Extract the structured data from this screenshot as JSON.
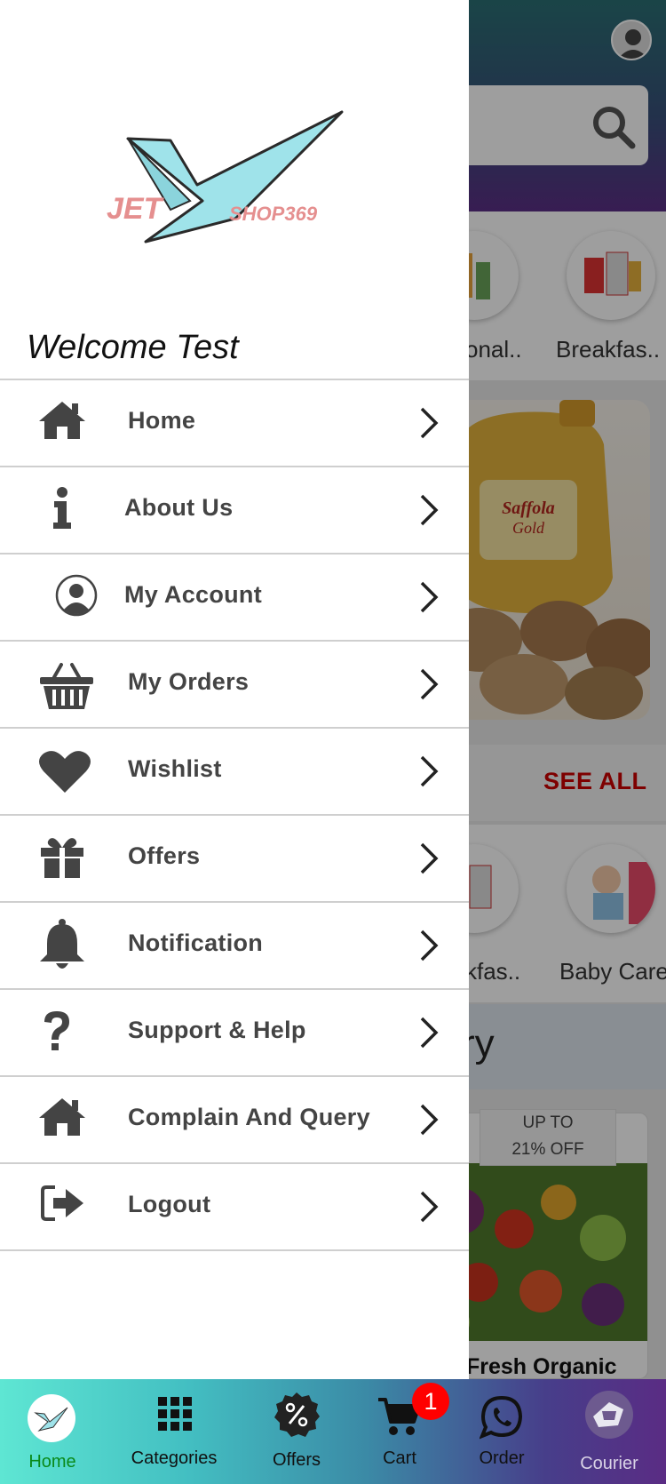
{
  "background": {
    "categories_row1": [
      {
        "label": "onal.."
      },
      {
        "label": "Breakfas.."
      }
    ],
    "see_all": "SEE ALL",
    "categories_row2": [
      {
        "label": "kfas.."
      },
      {
        "label": "Baby Care"
      }
    ],
    "section_title_partial": "ry",
    "product": {
      "deal_line1": "UP TO",
      "deal_line2": "21% OFF",
      "name": "Fresh Organic"
    },
    "banner_brand": "Saffola",
    "banner_sub": "Gold"
  },
  "drawer": {
    "logo": {
      "left": "JET",
      "right": "SHOP369"
    },
    "welcome": "Welcome Test",
    "menu": [
      {
        "label": "Home",
        "icon": "home-icon"
      },
      {
        "label": "About Us",
        "icon": "info-icon"
      },
      {
        "label": "My Account",
        "icon": "user-circle-icon"
      },
      {
        "label": "My Orders",
        "icon": "basket-icon"
      },
      {
        "label": "Wishlist",
        "icon": "heart-icon"
      },
      {
        "label": "Offers",
        "icon": "gift-icon"
      },
      {
        "label": "Notification",
        "icon": "bell-icon"
      },
      {
        "label": "Support & Help",
        "icon": "question-icon"
      },
      {
        "label": "Complain And Query",
        "icon": "home-icon"
      },
      {
        "label": "Logout",
        "icon": "logout-icon"
      }
    ]
  },
  "bottom_nav": {
    "items": [
      {
        "label": "Home",
        "icon": "logo-icon",
        "active": true,
        "color": "#0a8a1a"
      },
      {
        "label": "Categories",
        "icon": "grid-icon"
      },
      {
        "label": "Offers",
        "icon": "percent-badge-icon"
      },
      {
        "label": "Cart",
        "icon": "cart-icon"
      },
      {
        "label": "Order",
        "icon": "whatsapp-icon"
      },
      {
        "label": "Courier",
        "icon": "courier-icon"
      }
    ],
    "cart_badge": "1"
  },
  "colors": {
    "accent_red": "#cc0000",
    "active_nav": "#0a8a1a",
    "menu_text": "#444444",
    "badge": "#ff0000"
  }
}
